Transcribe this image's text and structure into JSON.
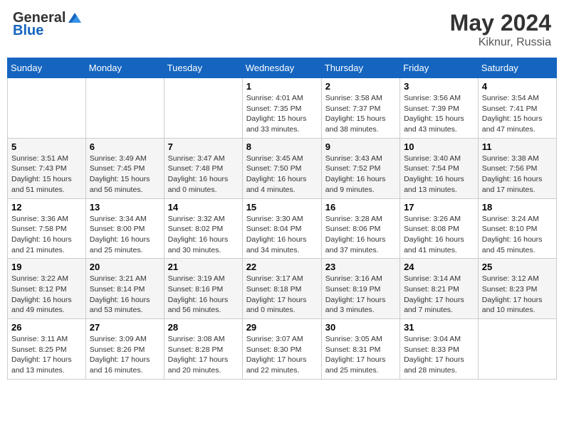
{
  "header": {
    "logo_general": "General",
    "logo_blue": "Blue",
    "month": "May 2024",
    "location": "Kiknur, Russia"
  },
  "weekdays": [
    "Sunday",
    "Monday",
    "Tuesday",
    "Wednesday",
    "Thursday",
    "Friday",
    "Saturday"
  ],
  "weeks": [
    [
      {
        "day": "",
        "info": ""
      },
      {
        "day": "",
        "info": ""
      },
      {
        "day": "",
        "info": ""
      },
      {
        "day": "1",
        "info": "Sunrise: 4:01 AM\nSunset: 7:35 PM\nDaylight: 15 hours\nand 33 minutes."
      },
      {
        "day": "2",
        "info": "Sunrise: 3:58 AM\nSunset: 7:37 PM\nDaylight: 15 hours\nand 38 minutes."
      },
      {
        "day": "3",
        "info": "Sunrise: 3:56 AM\nSunset: 7:39 PM\nDaylight: 15 hours\nand 43 minutes."
      },
      {
        "day": "4",
        "info": "Sunrise: 3:54 AM\nSunset: 7:41 PM\nDaylight: 15 hours\nand 47 minutes."
      }
    ],
    [
      {
        "day": "5",
        "info": "Sunrise: 3:51 AM\nSunset: 7:43 PM\nDaylight: 15 hours\nand 51 minutes."
      },
      {
        "day": "6",
        "info": "Sunrise: 3:49 AM\nSunset: 7:45 PM\nDaylight: 15 hours\nand 56 minutes."
      },
      {
        "day": "7",
        "info": "Sunrise: 3:47 AM\nSunset: 7:48 PM\nDaylight: 16 hours\nand 0 minutes."
      },
      {
        "day": "8",
        "info": "Sunrise: 3:45 AM\nSunset: 7:50 PM\nDaylight: 16 hours\nand 4 minutes."
      },
      {
        "day": "9",
        "info": "Sunrise: 3:43 AM\nSunset: 7:52 PM\nDaylight: 16 hours\nand 9 minutes."
      },
      {
        "day": "10",
        "info": "Sunrise: 3:40 AM\nSunset: 7:54 PM\nDaylight: 16 hours\nand 13 minutes."
      },
      {
        "day": "11",
        "info": "Sunrise: 3:38 AM\nSunset: 7:56 PM\nDaylight: 16 hours\nand 17 minutes."
      }
    ],
    [
      {
        "day": "12",
        "info": "Sunrise: 3:36 AM\nSunset: 7:58 PM\nDaylight: 16 hours\nand 21 minutes."
      },
      {
        "day": "13",
        "info": "Sunrise: 3:34 AM\nSunset: 8:00 PM\nDaylight: 16 hours\nand 25 minutes."
      },
      {
        "day": "14",
        "info": "Sunrise: 3:32 AM\nSunset: 8:02 PM\nDaylight: 16 hours\nand 30 minutes."
      },
      {
        "day": "15",
        "info": "Sunrise: 3:30 AM\nSunset: 8:04 PM\nDaylight: 16 hours\nand 34 minutes."
      },
      {
        "day": "16",
        "info": "Sunrise: 3:28 AM\nSunset: 8:06 PM\nDaylight: 16 hours\nand 37 minutes."
      },
      {
        "day": "17",
        "info": "Sunrise: 3:26 AM\nSunset: 8:08 PM\nDaylight: 16 hours\nand 41 minutes."
      },
      {
        "day": "18",
        "info": "Sunrise: 3:24 AM\nSunset: 8:10 PM\nDaylight: 16 hours\nand 45 minutes."
      }
    ],
    [
      {
        "day": "19",
        "info": "Sunrise: 3:22 AM\nSunset: 8:12 PM\nDaylight: 16 hours\nand 49 minutes."
      },
      {
        "day": "20",
        "info": "Sunrise: 3:21 AM\nSunset: 8:14 PM\nDaylight: 16 hours\nand 53 minutes."
      },
      {
        "day": "21",
        "info": "Sunrise: 3:19 AM\nSunset: 8:16 PM\nDaylight: 16 hours\nand 56 minutes."
      },
      {
        "day": "22",
        "info": "Sunrise: 3:17 AM\nSunset: 8:18 PM\nDaylight: 17 hours\nand 0 minutes."
      },
      {
        "day": "23",
        "info": "Sunrise: 3:16 AM\nSunset: 8:19 PM\nDaylight: 17 hours\nand 3 minutes."
      },
      {
        "day": "24",
        "info": "Sunrise: 3:14 AM\nSunset: 8:21 PM\nDaylight: 17 hours\nand 7 minutes."
      },
      {
        "day": "25",
        "info": "Sunrise: 3:12 AM\nSunset: 8:23 PM\nDaylight: 17 hours\nand 10 minutes."
      }
    ],
    [
      {
        "day": "26",
        "info": "Sunrise: 3:11 AM\nSunset: 8:25 PM\nDaylight: 17 hours\nand 13 minutes."
      },
      {
        "day": "27",
        "info": "Sunrise: 3:09 AM\nSunset: 8:26 PM\nDaylight: 17 hours\nand 16 minutes."
      },
      {
        "day": "28",
        "info": "Sunrise: 3:08 AM\nSunset: 8:28 PM\nDaylight: 17 hours\nand 20 minutes."
      },
      {
        "day": "29",
        "info": "Sunrise: 3:07 AM\nSunset: 8:30 PM\nDaylight: 17 hours\nand 22 minutes."
      },
      {
        "day": "30",
        "info": "Sunrise: 3:05 AM\nSunset: 8:31 PM\nDaylight: 17 hours\nand 25 minutes."
      },
      {
        "day": "31",
        "info": "Sunrise: 3:04 AM\nSunset: 8:33 PM\nDaylight: 17 hours\nand 28 minutes."
      },
      {
        "day": "",
        "info": ""
      }
    ]
  ]
}
